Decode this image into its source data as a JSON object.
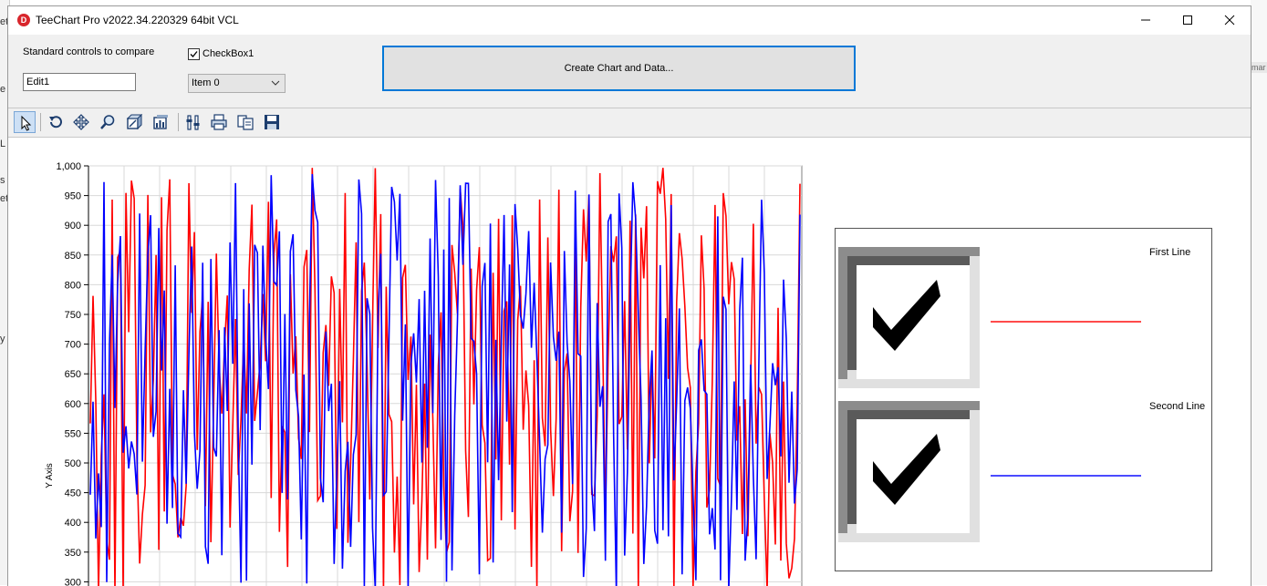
{
  "window": {
    "title": "TeeChart Pro v2022.34.220329 64bit VCL",
    "logo_letter": "D"
  },
  "panel": {
    "compare_label": "Standard controls to compare",
    "edit_value": "Edit1",
    "checkbox_label": "CheckBox1",
    "checkbox_checked": true,
    "combo_value": "Item 0",
    "create_button": "Create Chart and Data..."
  },
  "toolbar": {
    "tools": [
      "pointer-icon",
      "rotate-icon",
      "move-icon",
      "zoom-icon",
      "3d-depth-icon",
      "view-3d-icon",
      "edit-chart-icon",
      "print-icon",
      "copy-icon",
      "save-icon"
    ]
  },
  "legend": {
    "items": [
      {
        "name": "First Line",
        "color": "#ff0000",
        "checked": true
      },
      {
        "name": "Second Line",
        "color": "#0000ff",
        "checked": true
      }
    ]
  },
  "chart_data": {
    "type": "line",
    "ylabel": "Y Axis",
    "y_ticks": [
      "1,000",
      "950",
      "900",
      "850",
      "800",
      "750",
      "700",
      "650",
      "600",
      "550",
      "500",
      "450",
      "400",
      "350",
      "300"
    ],
    "ylim_visible": [
      300,
      1000
    ],
    "grid": true,
    "legend_position": "right",
    "series": [
      {
        "name": "First Line",
        "color": "#ff0000"
      },
      {
        "name": "Second Line",
        "color": "#0000ff"
      }
    ]
  },
  "desktop": {
    "left_glyphs": [
      "et",
      "e",
      "et",
      "L",
      "s",
      "et",
      "y"
    ],
    "right_text": "mar"
  }
}
